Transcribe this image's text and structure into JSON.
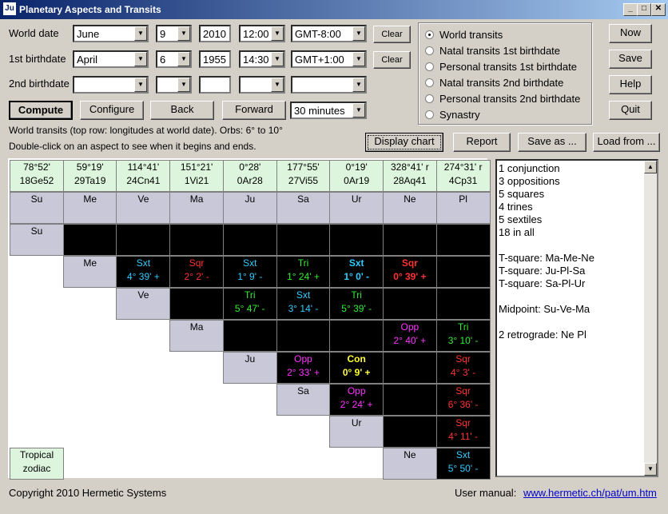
{
  "window": {
    "title": "Planetary Aspects and Transits",
    "icon": "Ju"
  },
  "form": {
    "world_label": "World date",
    "birth1_label": "1st birthdate",
    "birth2_label": "2nd birthdate",
    "world": {
      "month": "June",
      "day": "9",
      "year": "2010",
      "time": "12:00",
      "zone": "GMT-8:00"
    },
    "birth1": {
      "month": "April",
      "day": "6",
      "year": "1955",
      "time": "14:30",
      "zone": "GMT+1:00"
    },
    "clear_label": "Clear"
  },
  "buttons": {
    "compute": "Compute",
    "configure": "Configure",
    "back": "Back",
    "forward": "Forward",
    "interval": "30 minutes",
    "display_chart": "Display chart",
    "report": "Report",
    "save_as": "Save as ...",
    "load_from": "Load from ...",
    "now": "Now",
    "save": "Save",
    "help": "Help",
    "quit": "Quit"
  },
  "modes": [
    {
      "label": "World transits",
      "selected": true
    },
    {
      "label": "Natal transits 1st birthdate",
      "selected": false
    },
    {
      "label": "Personal transits 1st birthdate",
      "selected": false
    },
    {
      "label": "Natal transits 2nd birthdate",
      "selected": false
    },
    {
      "label": "Personal transits 2nd birthdate",
      "selected": false
    },
    {
      "label": "Synastry",
      "selected": false
    }
  ],
  "info": {
    "line1": "World transits (top row: longitudes at world date).  Orbs: 6° to 10°",
    "line2": "Double-click on an aspect to see when it begins and ends."
  },
  "longitudes": [
    {
      "deg": "78°52'",
      "sign": "18Ge52"
    },
    {
      "deg": "59°19'",
      "sign": "29Ta19"
    },
    {
      "deg": "114°41'",
      "sign": "24Cn41"
    },
    {
      "deg": "151°21'",
      "sign": "1Vi21"
    },
    {
      "deg": "0°28'",
      "sign": "0Ar28"
    },
    {
      "deg": "177°55'",
      "sign": "27Vi55"
    },
    {
      "deg": "0°19'",
      "sign": "0Ar19"
    },
    {
      "deg": "328°41' r",
      "sign": "28Aq41"
    },
    {
      "deg": "274°31' r",
      "sign": "4Cp31"
    }
  ],
  "planets": [
    "Su",
    "Me",
    "Ve",
    "Ma",
    "Ju",
    "Sa",
    "Ur",
    "Ne",
    "Pl"
  ],
  "aspects": [
    {
      "row": 1,
      "col": 2,
      "aspect": "Sxt",
      "orb": "4° 39' +",
      "color": "#33ccff",
      "bold": false
    },
    {
      "row": 1,
      "col": 3,
      "aspect": "Sqr",
      "orb": "2° 2' -",
      "color": "#ff3333",
      "bold": false
    },
    {
      "row": 1,
      "col": 4,
      "aspect": "Sxt",
      "orb": "1° 9' -",
      "color": "#33ccff",
      "bold": false
    },
    {
      "row": 1,
      "col": 5,
      "aspect": "Tri",
      "orb": "1° 24' +",
      "color": "#33ee33",
      "bold": false
    },
    {
      "row": 1,
      "col": 6,
      "aspect": "Sxt",
      "orb": "1° 0' -",
      "color": "#33ccff",
      "bold": true
    },
    {
      "row": 1,
      "col": 7,
      "aspect": "Sqr",
      "orb": "0° 39' +",
      "color": "#ff3333",
      "bold": true
    },
    {
      "row": 2,
      "col": 4,
      "aspect": "Tri",
      "orb": "5° 47' -",
      "color": "#33ee33",
      "bold": false
    },
    {
      "row": 2,
      "col": 5,
      "aspect": "Sxt",
      "orb": "3° 14' -",
      "color": "#33ccff",
      "bold": false
    },
    {
      "row": 2,
      "col": 6,
      "aspect": "Tri",
      "orb": "5° 39' -",
      "color": "#33ee33",
      "bold": false
    },
    {
      "row": 3,
      "col": 7,
      "aspect": "Opp",
      "orb": "2° 40' +",
      "color": "#ff33ff",
      "bold": false
    },
    {
      "row": 3,
      "col": 8,
      "aspect": "Tri",
      "orb": "3° 10' -",
      "color": "#33ee33",
      "bold": false
    },
    {
      "row": 4,
      "col": 5,
      "aspect": "Opp",
      "orb": "2° 33' +",
      "color": "#ff33ff",
      "bold": false
    },
    {
      "row": 4,
      "col": 6,
      "aspect": "Con",
      "orb": "0° 9' +",
      "color": "#ffff33",
      "bold": true
    },
    {
      "row": 4,
      "col": 8,
      "aspect": "Sqr",
      "orb": "4° 3' -",
      "color": "#ff3333",
      "bold": false
    },
    {
      "row": 5,
      "col": 6,
      "aspect": "Opp",
      "orb": "2° 24' +",
      "color": "#ff33ff",
      "bold": false
    },
    {
      "row": 5,
      "col": 8,
      "aspect": "Sqr",
      "orb": "6° 36' -",
      "color": "#ff3333",
      "bold": false
    },
    {
      "row": 6,
      "col": 8,
      "aspect": "Sqr",
      "orb": "4° 11' -",
      "color": "#ff3333",
      "bold": false
    },
    {
      "row": 7,
      "col": 8,
      "aspect": "Sxt",
      "orb": "5° 50' -",
      "color": "#33ccff",
      "bold": false
    }
  ],
  "zodiac": {
    "line1": "Tropical",
    "line2": "zodiac"
  },
  "summary": [
    "1 conjunction",
    "3 oppositions",
    "5 squares",
    "4 trines",
    "5 sextiles",
    "18 in all",
    "",
    "T-square: Ma-Me-Ne",
    "T-square: Ju-Pl-Sa",
    "T-square: Sa-Pl-Ur",
    "",
    "Midpoint: Su-Ve-Ma",
    "",
    "2 retrograde: Ne Pl"
  ],
  "footer": {
    "copyright": "Copyright 2010 Hermetic Systems",
    "manual_label": "User manual:",
    "manual_link": "www.hermetic.ch/pat/um.htm"
  }
}
